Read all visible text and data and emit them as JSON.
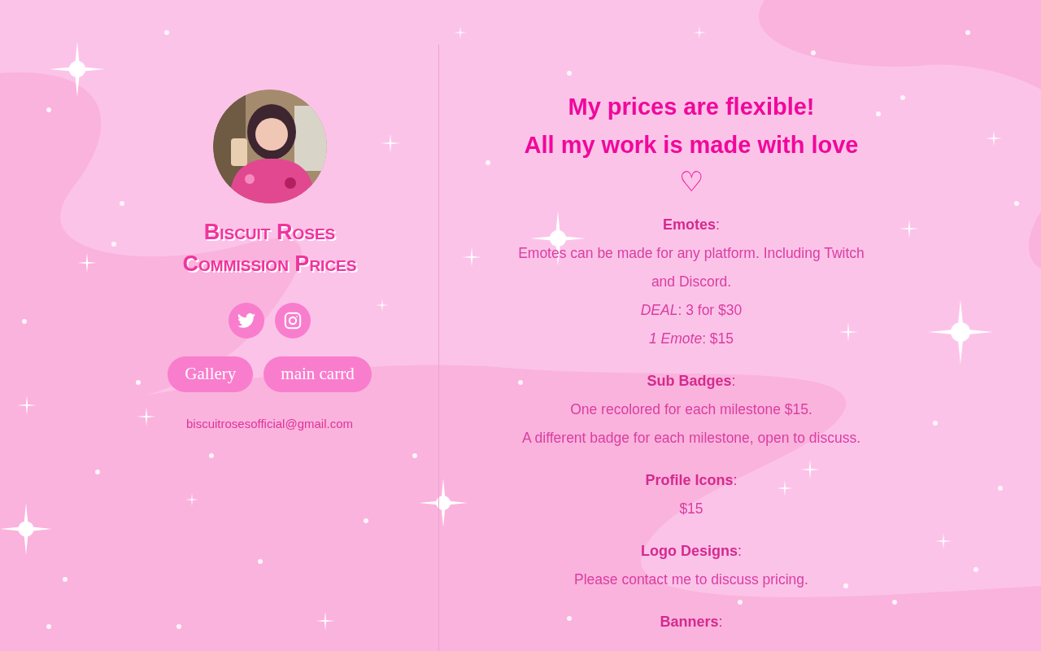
{
  "profile": {
    "avatar": {
      "kind": "picture"
    },
    "title_lines": [
      "Biscuit Roses",
      "Commission Prices"
    ],
    "socials": [
      {
        "kind": "twitter"
      },
      {
        "kind": "instagram"
      }
    ],
    "buttons": [
      "Gallery",
      "main carrd"
    ],
    "email": "biscuitrosesofficial@gmail.com"
  },
  "headline": {
    "lines": [
      "My prices are flexible!",
      "All my work is made with love"
    ],
    "heart": "♡"
  },
  "sections": [
    {
      "heading": "**Emotes**:",
      "lines": [
        "Emotes can be made for any platform. Including Twitch and Discord.",
        "*DEAL*: 3 for $30",
        "*1 Emote*: $15"
      ]
    },
    {
      "heading": "**Sub Badges**:",
      "lines": [
        "One recolored for each milestone $15.",
        "A different badge for each milestone, open to discuss."
      ]
    },
    {
      "heading": "**Profile Icons**:",
      "lines": [
        "$15"
      ]
    },
    {
      "heading": "**Logo Designs**:",
      "lines": [
        "Please contact me to discuss pricing."
      ]
    },
    {
      "heading": "**Banners**:"
    }
  ]
}
